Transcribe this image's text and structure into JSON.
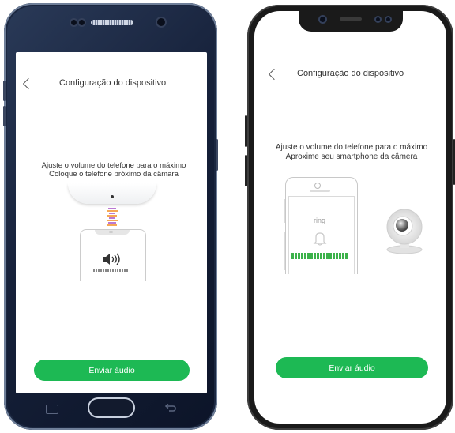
{
  "left_screen": {
    "title": "Configuração do dispositivo",
    "instruction_line1": "Ajuste o volume do telefone para o máximo",
    "instruction_line2": "Coloque o telefone próximo da câmara",
    "button_label": "Enviar áudio",
    "icons": [
      "back-icon",
      "camera-illustration",
      "sound-wave-icon",
      "phone-illustration",
      "speaker-icon"
    ]
  },
  "right_screen": {
    "title": "Configuração do dispositivo",
    "instruction_line1": "Ajuste o volume do telefone para o máximo",
    "instruction_line2": "Aproxime seu smartphone da câmera",
    "ring_text": "ring",
    "button_label": "Enviar áudio",
    "icons": [
      "back-icon",
      "phone-illustration",
      "bell-icon",
      "camera-illustration"
    ]
  },
  "colors": {
    "accent_green": "#1db954",
    "level_green": "#3cb24a",
    "wave_orange": "#f28a1c",
    "wave_purple": "#a44cc4"
  }
}
